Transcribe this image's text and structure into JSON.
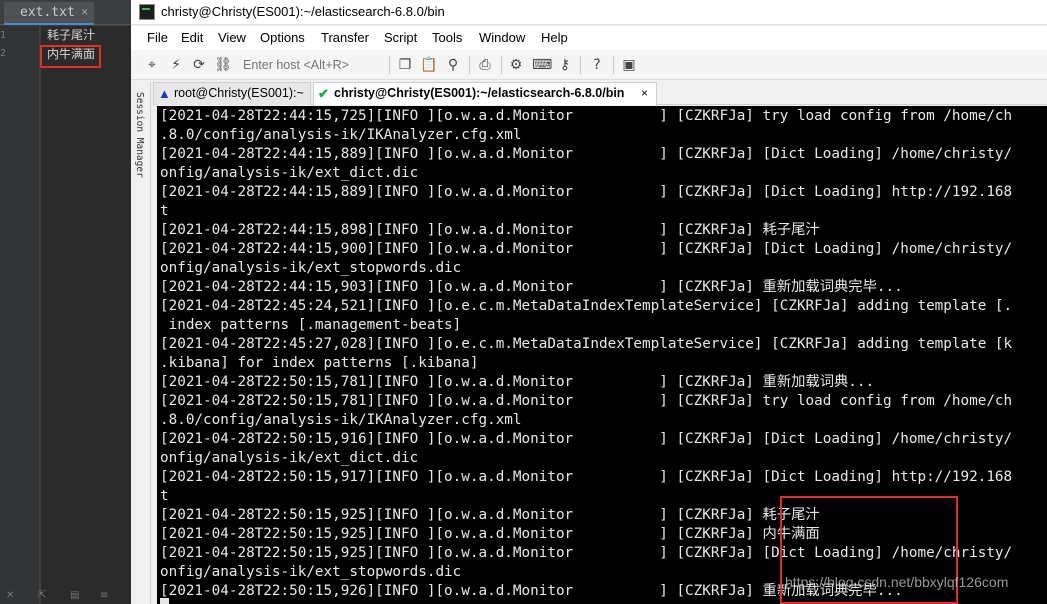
{
  "editor": {
    "tab_name": "ext.txt",
    "tab_close": "✕",
    "line_numbers": [
      "1",
      "2"
    ],
    "lines": [
      "耗子尾汁",
      "内牛满面"
    ],
    "highlight_color": "#e0302a"
  },
  "window": {
    "title": "christy@Christy(ES001):~/elasticsearch-6.8.0/bin"
  },
  "menu": {
    "items": [
      "File",
      "Edit",
      "View",
      "Options",
      "Transfer",
      "Script",
      "Tools",
      "Window",
      "Help"
    ]
  },
  "toolbar": {
    "host_placeholder": "Enter host <Alt+R>",
    "icons": [
      "connect-icon",
      "quick-connect-icon",
      "reconnect-icon",
      "disconnect-icon",
      "copy-icon",
      "paste-icon",
      "find-icon",
      "print-icon",
      "settings-icon",
      "keymap-icon",
      "sftp-icon",
      "help-icon",
      "screen-icon"
    ]
  },
  "session_manager": {
    "label": "Session Manager"
  },
  "tabs": [
    {
      "label": "root@Christy(ES001):~",
      "status": "warning"
    },
    {
      "label": "christy@Christy(ES001):~/elasticsearch-6.8.0/bin",
      "status": "connected",
      "close": "×"
    }
  ],
  "terminal": {
    "lines": [
      "[2021-04-28T22:44:15,725][INFO ][o.w.a.d.Monitor          ] [CZKRFJa] try load config from /home/ch",
      ".8.0/config/analysis-ik/IKAnalyzer.cfg.xml",
      "[2021-04-28T22:44:15,889][INFO ][o.w.a.d.Monitor          ] [CZKRFJa] [Dict Loading] /home/christy/",
      "onfig/analysis-ik/ext_dict.dic",
      "[2021-04-28T22:44:15,889][INFO ][o.w.a.d.Monitor          ] [CZKRFJa] [Dict Loading] http://192.168",
      "t",
      "[2021-04-28T22:44:15,898][INFO ][o.w.a.d.Monitor          ] [CZKRFJa] 耗子尾汁",
      "[2021-04-28T22:44:15,900][INFO ][o.w.a.d.Monitor          ] [CZKRFJa] [Dict Loading] /home/christy/",
      "onfig/analysis-ik/ext_stopwords.dic",
      "[2021-04-28T22:44:15,903][INFO ][o.w.a.d.Monitor          ] [CZKRFJa] 重新加载词典完毕...",
      "[2021-04-28T22:45:24,521][INFO ][o.e.c.m.MetaDataIndexTemplateService] [CZKRFJa] adding template [.",
      " index patterns [.management-beats]",
      "[2021-04-28T22:45:27,028][INFO ][o.e.c.m.MetaDataIndexTemplateService] [CZKRFJa] adding template [k",
      ".kibana] for index patterns [.kibana]",
      "[2021-04-28T22:50:15,781][INFO ][o.w.a.d.Monitor          ] [CZKRFJa] 重新加载词典...",
      "[2021-04-28T22:50:15,781][INFO ][o.w.a.d.Monitor          ] [CZKRFJa] try load config from /home/ch",
      ".8.0/config/analysis-ik/IKAnalyzer.cfg.xml",
      "[2021-04-28T22:50:15,916][INFO ][o.w.a.d.Monitor          ] [CZKRFJa] [Dict Loading] /home/christy/",
      "onfig/analysis-ik/ext_dict.dic",
      "[2021-04-28T22:50:15,917][INFO ][o.w.a.d.Monitor          ] [CZKRFJa] [Dict Loading] http://192.168",
      "t",
      "[2021-04-28T22:50:15,925][INFO ][o.w.a.d.Monitor          ] [CZKRFJa] 耗子尾汁",
      "[2021-04-28T22:50:15,925][INFO ][o.w.a.d.Monitor          ] [CZKRFJa] 内牛满面",
      "[2021-04-28T22:50:15,925][INFO ][o.w.a.d.Monitor          ] [CZKRFJa] [Dict Loading] /home/christy/",
      "onfig/analysis-ik/ext_stopwords.dic",
      "[2021-04-28T22:50:15,926][INFO ][o.w.a.d.Monitor          ] [CZKRFJa] 重新加载词典完毕..."
    ],
    "background": "#000000",
    "foreground": "#e8e8e8",
    "highlight_color": "#d93030",
    "watermark": "https://blog.csdn.net/bbxylqf126com"
  }
}
